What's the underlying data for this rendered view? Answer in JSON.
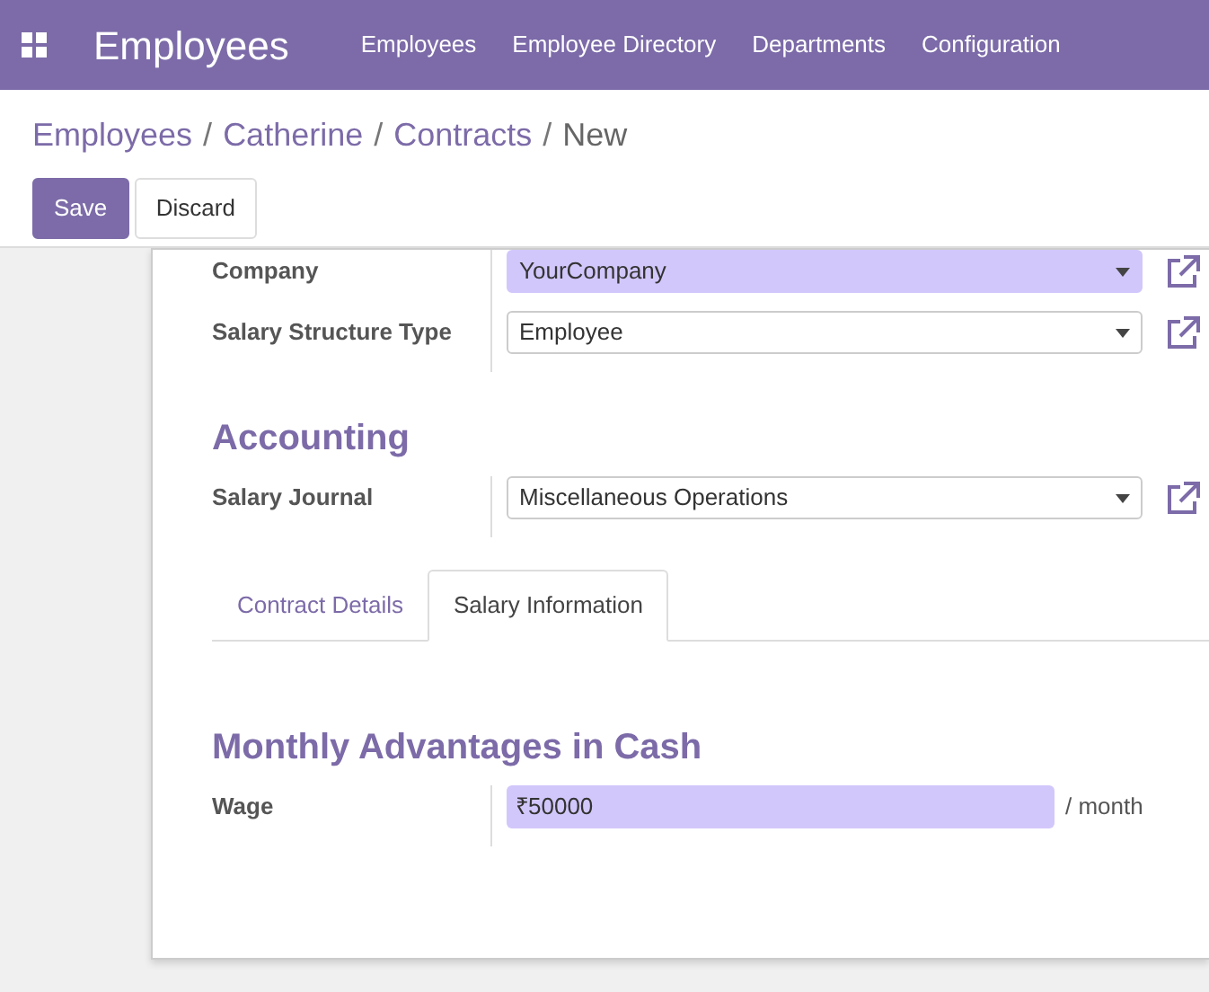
{
  "app": {
    "title": "Employees"
  },
  "menu": [
    {
      "label": "Employees"
    },
    {
      "label": "Employee Directory"
    },
    {
      "label": "Departments"
    },
    {
      "label": "Configuration"
    }
  ],
  "breadcrumb": [
    {
      "label": "Employees",
      "kind": "link"
    },
    {
      "label": "/",
      "kind": "separator"
    },
    {
      "label": "Catherine",
      "kind": "link"
    },
    {
      "label": "/",
      "kind": "separator"
    },
    {
      "label": "Contracts",
      "kind": "link"
    },
    {
      "label": "/",
      "kind": "separator"
    },
    {
      "label": "New",
      "kind": "current"
    }
  ],
  "buttons": [
    {
      "label": "Save",
      "kind": "primary"
    },
    {
      "label": "Discard",
      "kind": "secondary"
    }
  ],
  "top_fields": [
    {
      "label": "Company",
      "value": "YourCompany",
      "required": true,
      "kind": "select"
    },
    {
      "label": "Salary Structure Type",
      "value": "Employee",
      "required": false,
      "kind": "select"
    }
  ],
  "accounting": {
    "title": "Accounting",
    "fields": [
      {
        "label": "Salary Journal",
        "value": "Miscellaneous Operations",
        "required": false,
        "kind": "select"
      }
    ]
  },
  "tabs": [
    {
      "label": "Contract Details",
      "selected": false
    },
    {
      "label": "Salary Information",
      "selected": true
    }
  ],
  "advantages": {
    "title": "Monthly Advantages in Cash",
    "fields": [
      {
        "label": "Wage",
        "value": "₹50000",
        "required": true,
        "kind": "monetary",
        "suffix": "/ month"
      }
    ]
  }
}
